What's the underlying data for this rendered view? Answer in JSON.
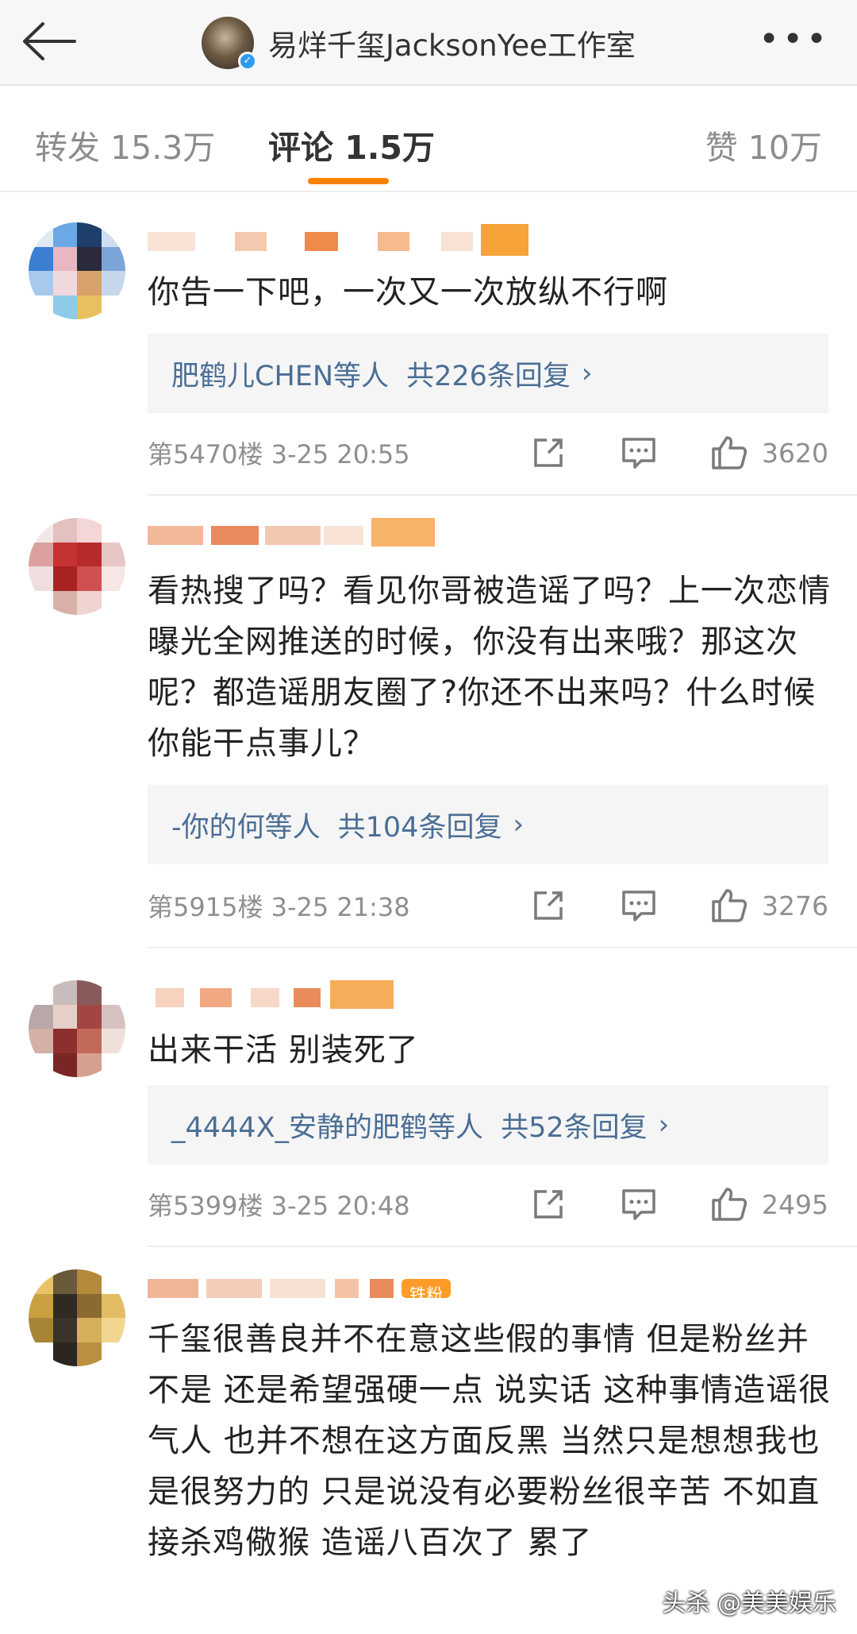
{
  "header": {
    "title": "易烊千玺JacksonYee工作室",
    "more": "•••"
  },
  "tabs": [
    {
      "label": "转发 15.3万"
    },
    {
      "label": "评论 1.5万"
    },
    {
      "label": "赞 10万"
    }
  ],
  "comments": [
    {
      "text": "你告一下吧，一次又一次放纵不行啊",
      "replies_users": "肥鹤儿CHEN等人",
      "replies_total": "共226条回复",
      "floor_time": "第5470楼  3-25 20:55",
      "likes": "3620"
    },
    {
      "text": "看热搜了吗？看见你哥被造谣了吗？上一次恋情曝光全网推送的时候，你没有出来哦？那这次呢？都造谣朋友圈了?你还不出来吗？什么时候你能干点事儿？",
      "replies_users": "-你的何等人",
      "replies_total": "共104条回复",
      "floor_time": "第5915楼  3-25 21:38",
      "likes": "3276"
    },
    {
      "text": "出来干活 别装死了",
      "replies_users": "_4444X_安静的肥鹤等人",
      "replies_total": "共52条回复",
      "floor_time": "第5399楼  3-25 20:48",
      "likes": "2495"
    },
    {
      "badge": "铁粉",
      "text": "千玺很善良并不在意这些假的事情 但是粉丝并不是 还是希望强硬一点 说实话 这种事情造谣很气人 也并不想在这方面反黑 当然只是想想我也是很努力的 只是说没有必要粉丝很辛苦 不如直接杀鸡儆猴 造谣八百次了 累了"
    }
  ],
  "watermark": "头杀 @美美娱乐",
  "colors": {
    "accent": "#ff8200",
    "link": "#4a6e95",
    "verify": "#2d9bf0",
    "fan_badge": "#ff9b26"
  }
}
